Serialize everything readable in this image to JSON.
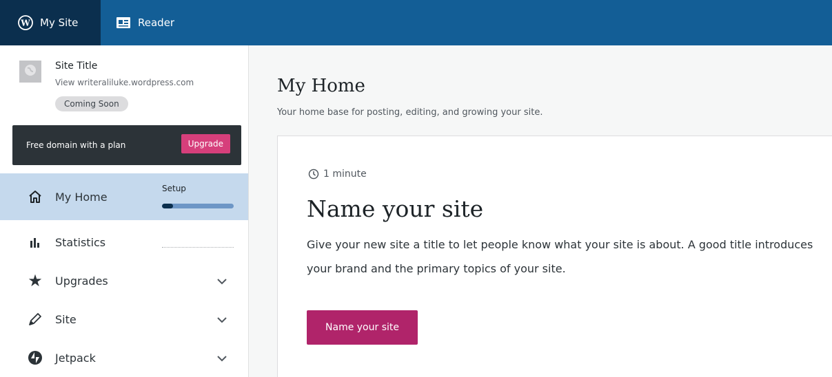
{
  "topbar": {
    "my_site_label": "My Site",
    "reader_label": "Reader"
  },
  "sidebar": {
    "site": {
      "title": "Site Title",
      "url": "View writeraliluke.wordpress.com",
      "badge": "Coming Soon"
    },
    "upsell": {
      "text": "Free domain with a plan",
      "button": "Upgrade"
    },
    "setup": {
      "label": "Setup",
      "progress": 0.15
    },
    "items": [
      {
        "label": "My Home",
        "icon": "home-icon",
        "active": true
      },
      {
        "label": "Statistics",
        "icon": "stats-icon"
      },
      {
        "label": "Upgrades",
        "icon": "star-icon",
        "expandable": true
      },
      {
        "label": "Site",
        "icon": "pencil-icon",
        "expandable": true
      },
      {
        "label": "Jetpack",
        "icon": "jetpack-icon",
        "expandable": true
      }
    ]
  },
  "main": {
    "title": "My Home",
    "subtitle": "Your home base for posting, editing, and growing your site.",
    "task": {
      "duration": "1 minute",
      "title": "Name your site",
      "description": "Give your new site a title to let people know what your site is about. A good title introduces your brand and the primary topics of your site.",
      "button": "Name your site"
    }
  },
  "colors": {
    "topbar": "#135e96",
    "topbar_active": "#0b2f4e",
    "accent": "#b0246a",
    "upgrade": "#d63f7b",
    "sidebar_active": "#c5d9ed"
  }
}
